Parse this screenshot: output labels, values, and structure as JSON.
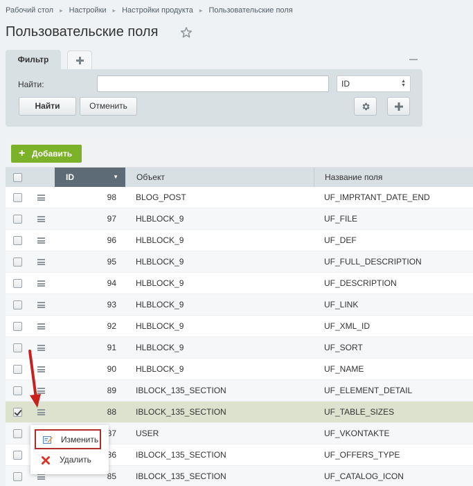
{
  "breadcrumb": [
    "Рабочий стол",
    "Настройки",
    "Настройки продукта",
    "Пользовательские поля"
  ],
  "page_title": "Пользовательские поля",
  "filter": {
    "tab_label": "Фильтр",
    "find_label": "Найти:",
    "search_value": "",
    "field_select": "ID",
    "find_button": "Найти",
    "cancel_button": "Отменить"
  },
  "toolbar": {
    "add_button": "Добавить"
  },
  "grid": {
    "columns": {
      "id": "ID",
      "object": "Объект",
      "field_name": "Название поля"
    },
    "rows": [
      {
        "id": "98",
        "object": "BLOG_POST",
        "field_name": "UF_IMPRTANT_DATE_END",
        "checked": false
      },
      {
        "id": "97",
        "object": "HLBLOCK_9",
        "field_name": "UF_FILE",
        "checked": false
      },
      {
        "id": "96",
        "object": "HLBLOCK_9",
        "field_name": "UF_DEF",
        "checked": false
      },
      {
        "id": "95",
        "object": "HLBLOCK_9",
        "field_name": "UF_FULL_DESCRIPTION",
        "checked": false
      },
      {
        "id": "94",
        "object": "HLBLOCK_9",
        "field_name": "UF_DESCRIPTION",
        "checked": false
      },
      {
        "id": "93",
        "object": "HLBLOCK_9",
        "field_name": "UF_LINK",
        "checked": false
      },
      {
        "id": "92",
        "object": "HLBLOCK_9",
        "field_name": "UF_XML_ID",
        "checked": false
      },
      {
        "id": "91",
        "object": "HLBLOCK_9",
        "field_name": "UF_SORT",
        "checked": false
      },
      {
        "id": "90",
        "object": "HLBLOCK_9",
        "field_name": "UF_NAME",
        "checked": false
      },
      {
        "id": "89",
        "object": "IBLOCK_135_SECTION",
        "field_name": "UF_ELEMENT_DETAIL",
        "checked": false
      },
      {
        "id": "88",
        "object": "IBLOCK_135_SECTION",
        "field_name": "UF_TABLE_SIZES",
        "checked": true
      },
      {
        "id": "87",
        "object": "USER",
        "field_name": "UF_VKONTAKTE",
        "checked": false
      },
      {
        "id": "86",
        "object": "IBLOCK_135_SECTION",
        "field_name": "UF_OFFERS_TYPE",
        "checked": false
      },
      {
        "id": "85",
        "object": "IBLOCK_135_SECTION",
        "field_name": "UF_CATALOG_ICON",
        "checked": false
      }
    ]
  },
  "context_menu": {
    "edit": "Изменить",
    "delete": "Удалить"
  },
  "colors": {
    "accent_green": "#7cb22a",
    "selected_row": "#dde2cf",
    "highlight_red": "#b32b2b",
    "sorted_header": "#5c6b76"
  }
}
